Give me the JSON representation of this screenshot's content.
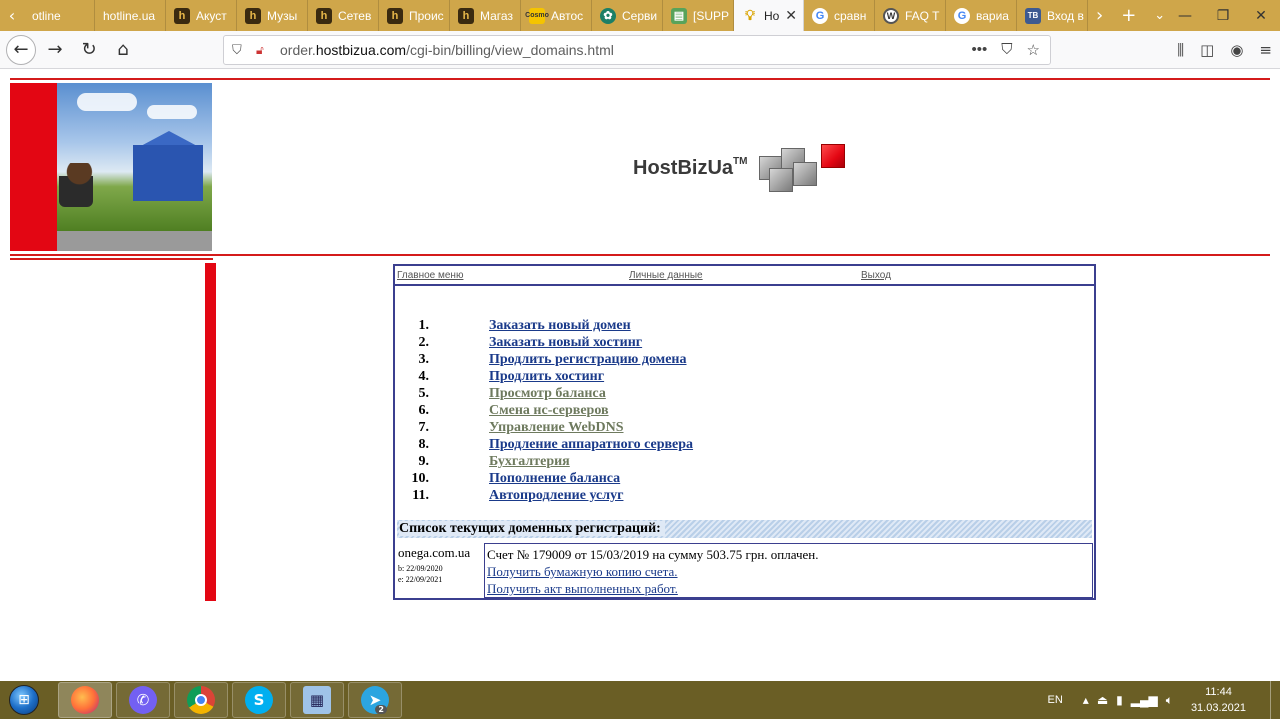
{
  "browser": {
    "tabs": [
      {
        "label": "otline",
        "icon": "none",
        "active": false
      },
      {
        "label": "hotline.ua",
        "icon": "none",
        "active": false
      },
      {
        "label": "Акуст",
        "icon": "h",
        "active": false
      },
      {
        "label": "Музы",
        "icon": "h",
        "active": false
      },
      {
        "label": "Сетев",
        "icon": "h",
        "active": false
      },
      {
        "label": "Проис",
        "icon": "h",
        "active": false
      },
      {
        "label": "Магаз",
        "icon": "h",
        "active": false
      },
      {
        "label": "Автос",
        "icon": "cosmo",
        "active": false
      },
      {
        "label": "Серви",
        "icon": "green",
        "active": false
      },
      {
        "label": "[SUPP",
        "icon": "support",
        "active": false
      },
      {
        "label": "Ho",
        "icon": "bulb",
        "active": true
      },
      {
        "label": "сравн",
        "icon": "g",
        "active": false
      },
      {
        "label": "FAQ T",
        "icon": "wp",
        "active": false
      },
      {
        "label": "вариа",
        "icon": "g",
        "active": false
      },
      {
        "label": "Вход в",
        "icon": "tb",
        "active": false
      }
    ],
    "url_prefix": "order.",
    "url_domain": "hostbizua.com",
    "url_path": "/cgi-bin/billing/view_domains.html"
  },
  "site": {
    "logo_text": "HostBizUa",
    "logo_tm": "TM"
  },
  "topmenu": {
    "main": "Главное меню",
    "personal": "Личные данные",
    "exit": "Выход"
  },
  "menu_items": [
    {
      "num": "1.",
      "label": "Заказать новый домен",
      "state": "active"
    },
    {
      "num": "2.",
      "label": "Заказать новый хостинг",
      "state": "active"
    },
    {
      "num": "3.",
      "label": "Продлить регистрацию домена",
      "state": "active"
    },
    {
      "num": "4.",
      "label": "Продлить хостинг",
      "state": "active"
    },
    {
      "num": "5.",
      "label": "Просмотр баланса",
      "state": "muted"
    },
    {
      "num": "6.",
      "label": "Смена нс-серверов",
      "state": "muted"
    },
    {
      "num": "7.",
      "label": "Управление WebDNS",
      "state": "muted"
    },
    {
      "num": "8.",
      "label": "Продление аппаратного сервера",
      "state": "active"
    },
    {
      "num": "9.",
      "label": "Бухгалтерия",
      "state": "muted"
    },
    {
      "num": "10.",
      "label": "Пополнение баланса",
      "state": "active"
    },
    {
      "num": "11.",
      "label": "Автопродление услуг",
      "state": "active"
    }
  ],
  "domains": {
    "header": "Список текущих доменных регистраций:",
    "items": [
      {
        "name": "onega.com.ua",
        "begin": "b: 22/09/2020",
        "end": "e: 22/09/2021",
        "invoice_text": "Счет № 179009 от 15/03/2019 на сумму 503.75 грн. оплачен.",
        "paper_copy_link": "Получить бумажную копию счета.",
        "act_link": "Получить акт выполненных работ."
      }
    ]
  },
  "taskbar": {
    "telegram_badge": "2",
    "lang": "EN",
    "time": "11:44",
    "date": "31.03.2021"
  },
  "colors": {
    "brand_red": "#e30613",
    "panel_border": "#3b3f8f",
    "link_active": "#1a3a8a",
    "link_muted": "#6e7a5e",
    "tabbar": "#cfa64a",
    "taskbar": "#6a5e25"
  }
}
